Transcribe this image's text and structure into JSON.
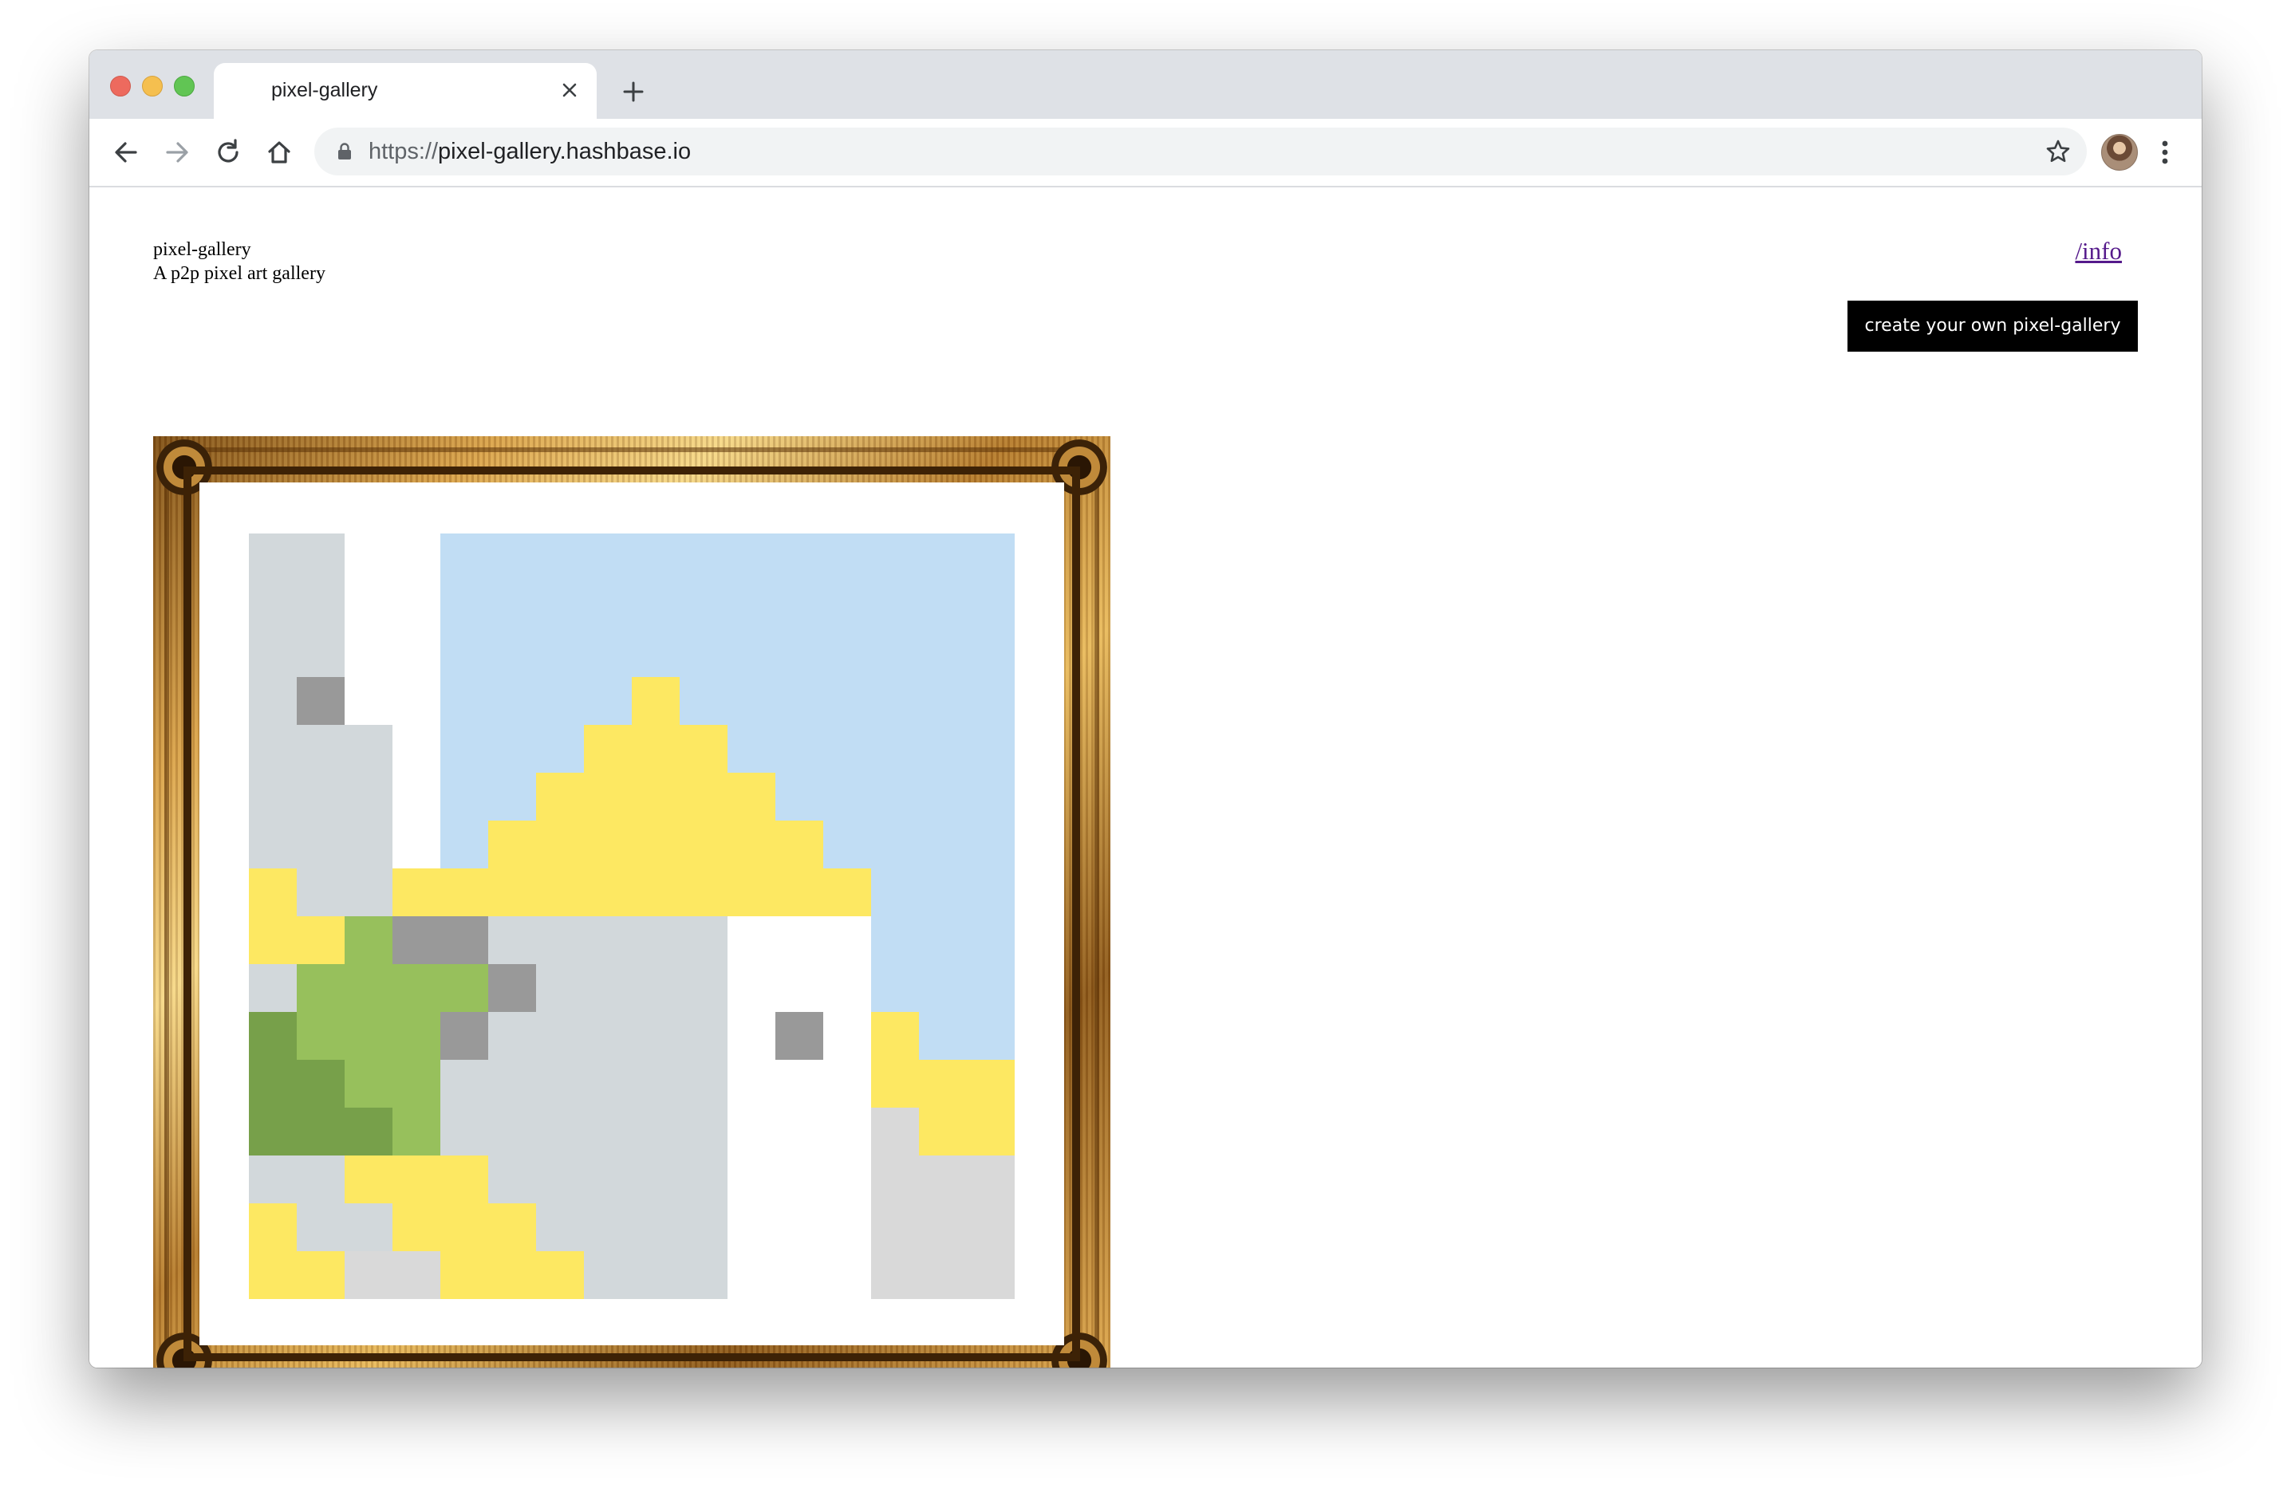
{
  "browser": {
    "tab_title": "pixel-gallery",
    "url_scheme": "https://",
    "url_host": "pixel-gallery.hashbase.io"
  },
  "site": {
    "title": "pixel-gallery",
    "subtitle": "A p2p pixel art gallery",
    "info_link": "/info",
    "create_button": "create your own pixel-gallery"
  },
  "colors": {
    "white": "#ffffff",
    "lightgray": "#d2d8db",
    "gray": "#999999",
    "sky": "#c1ddf4",
    "yellow": "#fde862",
    "lightgreen": "#97c05c",
    "darkgreen": "#77a04a",
    "paleground": "#d9d9d9"
  },
  "artwork": {
    "grid_size": 16,
    "legend": {
      "W": "white",
      "L": "lightgray",
      "G": "gray",
      "S": "sky",
      "Y": "yellow",
      "g": "lightgreen",
      "D": "darkgreen",
      "P": "paleground"
    },
    "rows": [
      "LLWWSSSSSSSSSSSS",
      "LLWWSSSSSSSSSSSS",
      "LLWWSSSSSSSSSSSS",
      "LGWWSSSSYSSSSSSS",
      "LLLWSSSYYYSSSSSS",
      "LLLWSSYYYYYSSSSS",
      "LLLWSYYYYYYYSSSS",
      "YLLYYYYYYYYYYSSS",
      "YYgGGLLLLLWWWSSS",
      "LggggGLLLLWWWSSS",
      "DgggGLLLLLWGWYSS",
      "DDggLLLLLLWWWYYY",
      "DDDgLLLLLLWWWPYY",
      "LLYYYLLLLLWWWPPP",
      "YLLYYYLLLLWWWPPP",
      "YYPPYYYLLLWWWPPP"
    ]
  }
}
